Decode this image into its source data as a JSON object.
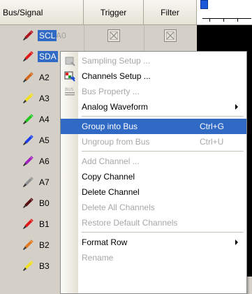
{
  "columns": {
    "bus_signal": "Bus/Signal",
    "trigger": "Trigger",
    "filter": "Filter"
  },
  "signals": [
    {
      "name": "SCL",
      "pin": "A0",
      "color": "#b0141e",
      "selected": true
    },
    {
      "name": "SDA",
      "pin": "",
      "color": "#e01818",
      "selected": true
    },
    {
      "name": "A2",
      "pin": "",
      "color": "#d2691e",
      "selected": false
    },
    {
      "name": "A3",
      "pin": "",
      "color": "#f0e020",
      "selected": false
    },
    {
      "name": "A4",
      "pin": "",
      "color": "#22c822",
      "selected": false
    },
    {
      "name": "A5",
      "pin": "",
      "color": "#1c3ef0",
      "selected": false
    },
    {
      "name": "A6",
      "pin": "",
      "color": "#a020c0",
      "selected": false
    },
    {
      "name": "A7",
      "pin": "",
      "color": "#909090",
      "selected": false
    },
    {
      "name": "B0",
      "pin": "",
      "color": "#5a0e14",
      "selected": false
    },
    {
      "name": "B1",
      "pin": "",
      "color": "#e01818",
      "selected": false
    },
    {
      "name": "B2",
      "pin": "",
      "color": "#e07820",
      "selected": false
    },
    {
      "name": "B3",
      "pin": "",
      "color": "#f0e020",
      "selected": false
    }
  ],
  "menu": {
    "items": [
      {
        "label": "Sampling Setup ...",
        "shortcut": "",
        "enabled": false,
        "icon": "sampling-setup-icon"
      },
      {
        "label": "Channels Setup ...",
        "shortcut": "",
        "enabled": true,
        "icon": "channels-setup-icon"
      },
      {
        "label": "Bus Property ...",
        "shortcut": "",
        "enabled": false,
        "icon": "bus-property-icon",
        "icon_text": "BUS"
      },
      {
        "label": "Analog Waveform",
        "shortcut": "",
        "enabled": true,
        "submenu": true
      },
      {
        "label": "Group into Bus",
        "shortcut": "Ctrl+G",
        "enabled": true,
        "highlighted": true
      },
      {
        "label": "Ungroup from Bus",
        "shortcut": "Ctrl+U",
        "enabled": false
      },
      {
        "label": "Add Channel ...",
        "shortcut": "",
        "enabled": false
      },
      {
        "label": "Copy Channel",
        "shortcut": "",
        "enabled": true
      },
      {
        "label": "Delete Channel",
        "shortcut": "",
        "enabled": true
      },
      {
        "label": "Delete All Channels",
        "shortcut": "",
        "enabled": false
      },
      {
        "label": "Restore Default Channels",
        "shortcut": "",
        "enabled": false
      },
      {
        "label": "Format Row",
        "shortcut": "",
        "enabled": true,
        "submenu": true
      },
      {
        "label": "Rename",
        "shortcut": "",
        "enabled": false
      }
    ]
  },
  "colors": {
    "highlight": "#316ac5",
    "disabled_text": "#a7a6aa",
    "panel": "#d4d0c8"
  }
}
